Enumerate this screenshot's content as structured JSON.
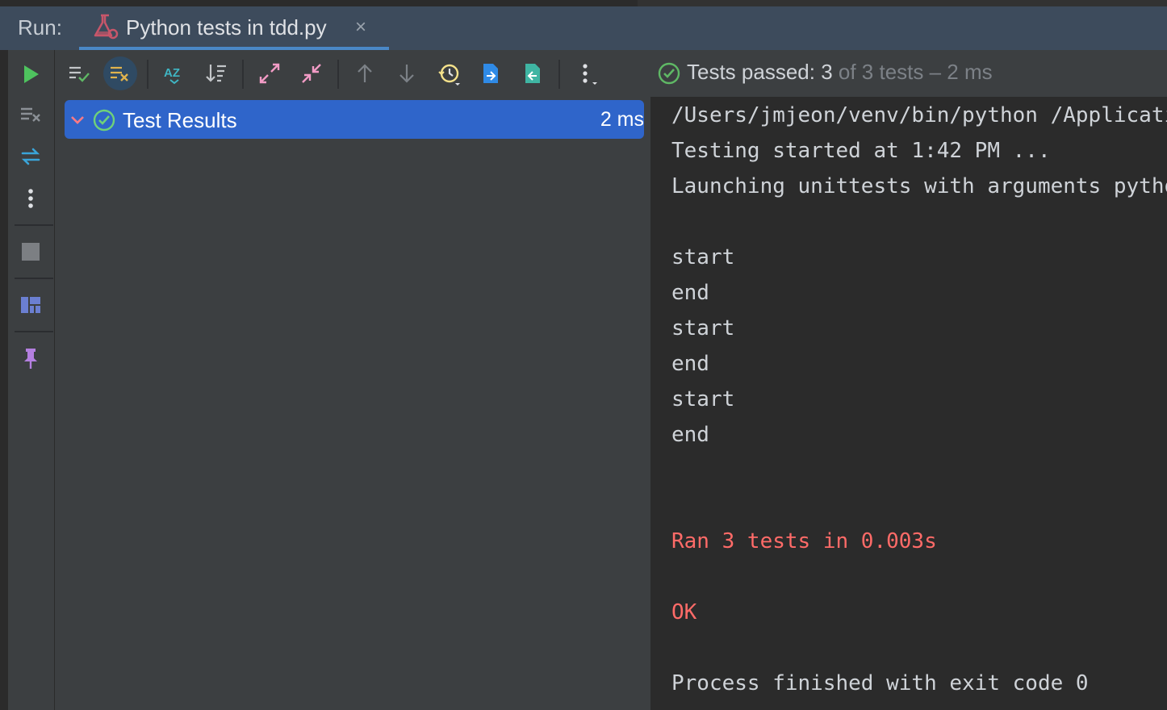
{
  "run_panel": {
    "label": "Run:",
    "tab": {
      "title": "Python tests in tdd.py",
      "close_glyph": "×"
    }
  },
  "sidebar": {
    "icons": [
      "rerun-icon",
      "clear-all-icon",
      "swap-icon",
      "more-vertical-icon",
      "stop-icon",
      "layout-icon",
      "pin-icon"
    ]
  },
  "toolbar": {
    "buttons": [
      "show-passed-icon",
      "show-ignored-icon",
      "sort-alphabetically-icon",
      "sort-by-duration-icon",
      "expand-all-icon",
      "collapse-all-icon",
      "previous-failed-icon",
      "next-failed-icon",
      "test-history-icon",
      "import-tests-icon",
      "export-tests-icon",
      "more-options-icon"
    ],
    "status": {
      "prefix": "Tests passed: 3",
      "suffix": " of 3 tests – 2 ms"
    }
  },
  "tree": {
    "root": {
      "label": "Test Results",
      "duration": "2 ms"
    }
  },
  "console": {
    "lines": [
      "/Users/jmjeon/venv/bin/python /Applicati",
      "Testing started at 1:42 PM ...",
      "Launching unittests with arguments pytho",
      "",
      "start",
      "end",
      "start",
      "end",
      "start",
      "end",
      "",
      "",
      "Ran 3 tests in 0.003s",
      "",
      "OK",
      "",
      "Process finished with exit code 0"
    ]
  },
  "colors": {
    "tab_bar": "#3d4b5c",
    "selection": "#2f65ca",
    "pass_green": "#5fb865",
    "error_red": "#ff6b68",
    "run_green": "#4ec35e"
  }
}
